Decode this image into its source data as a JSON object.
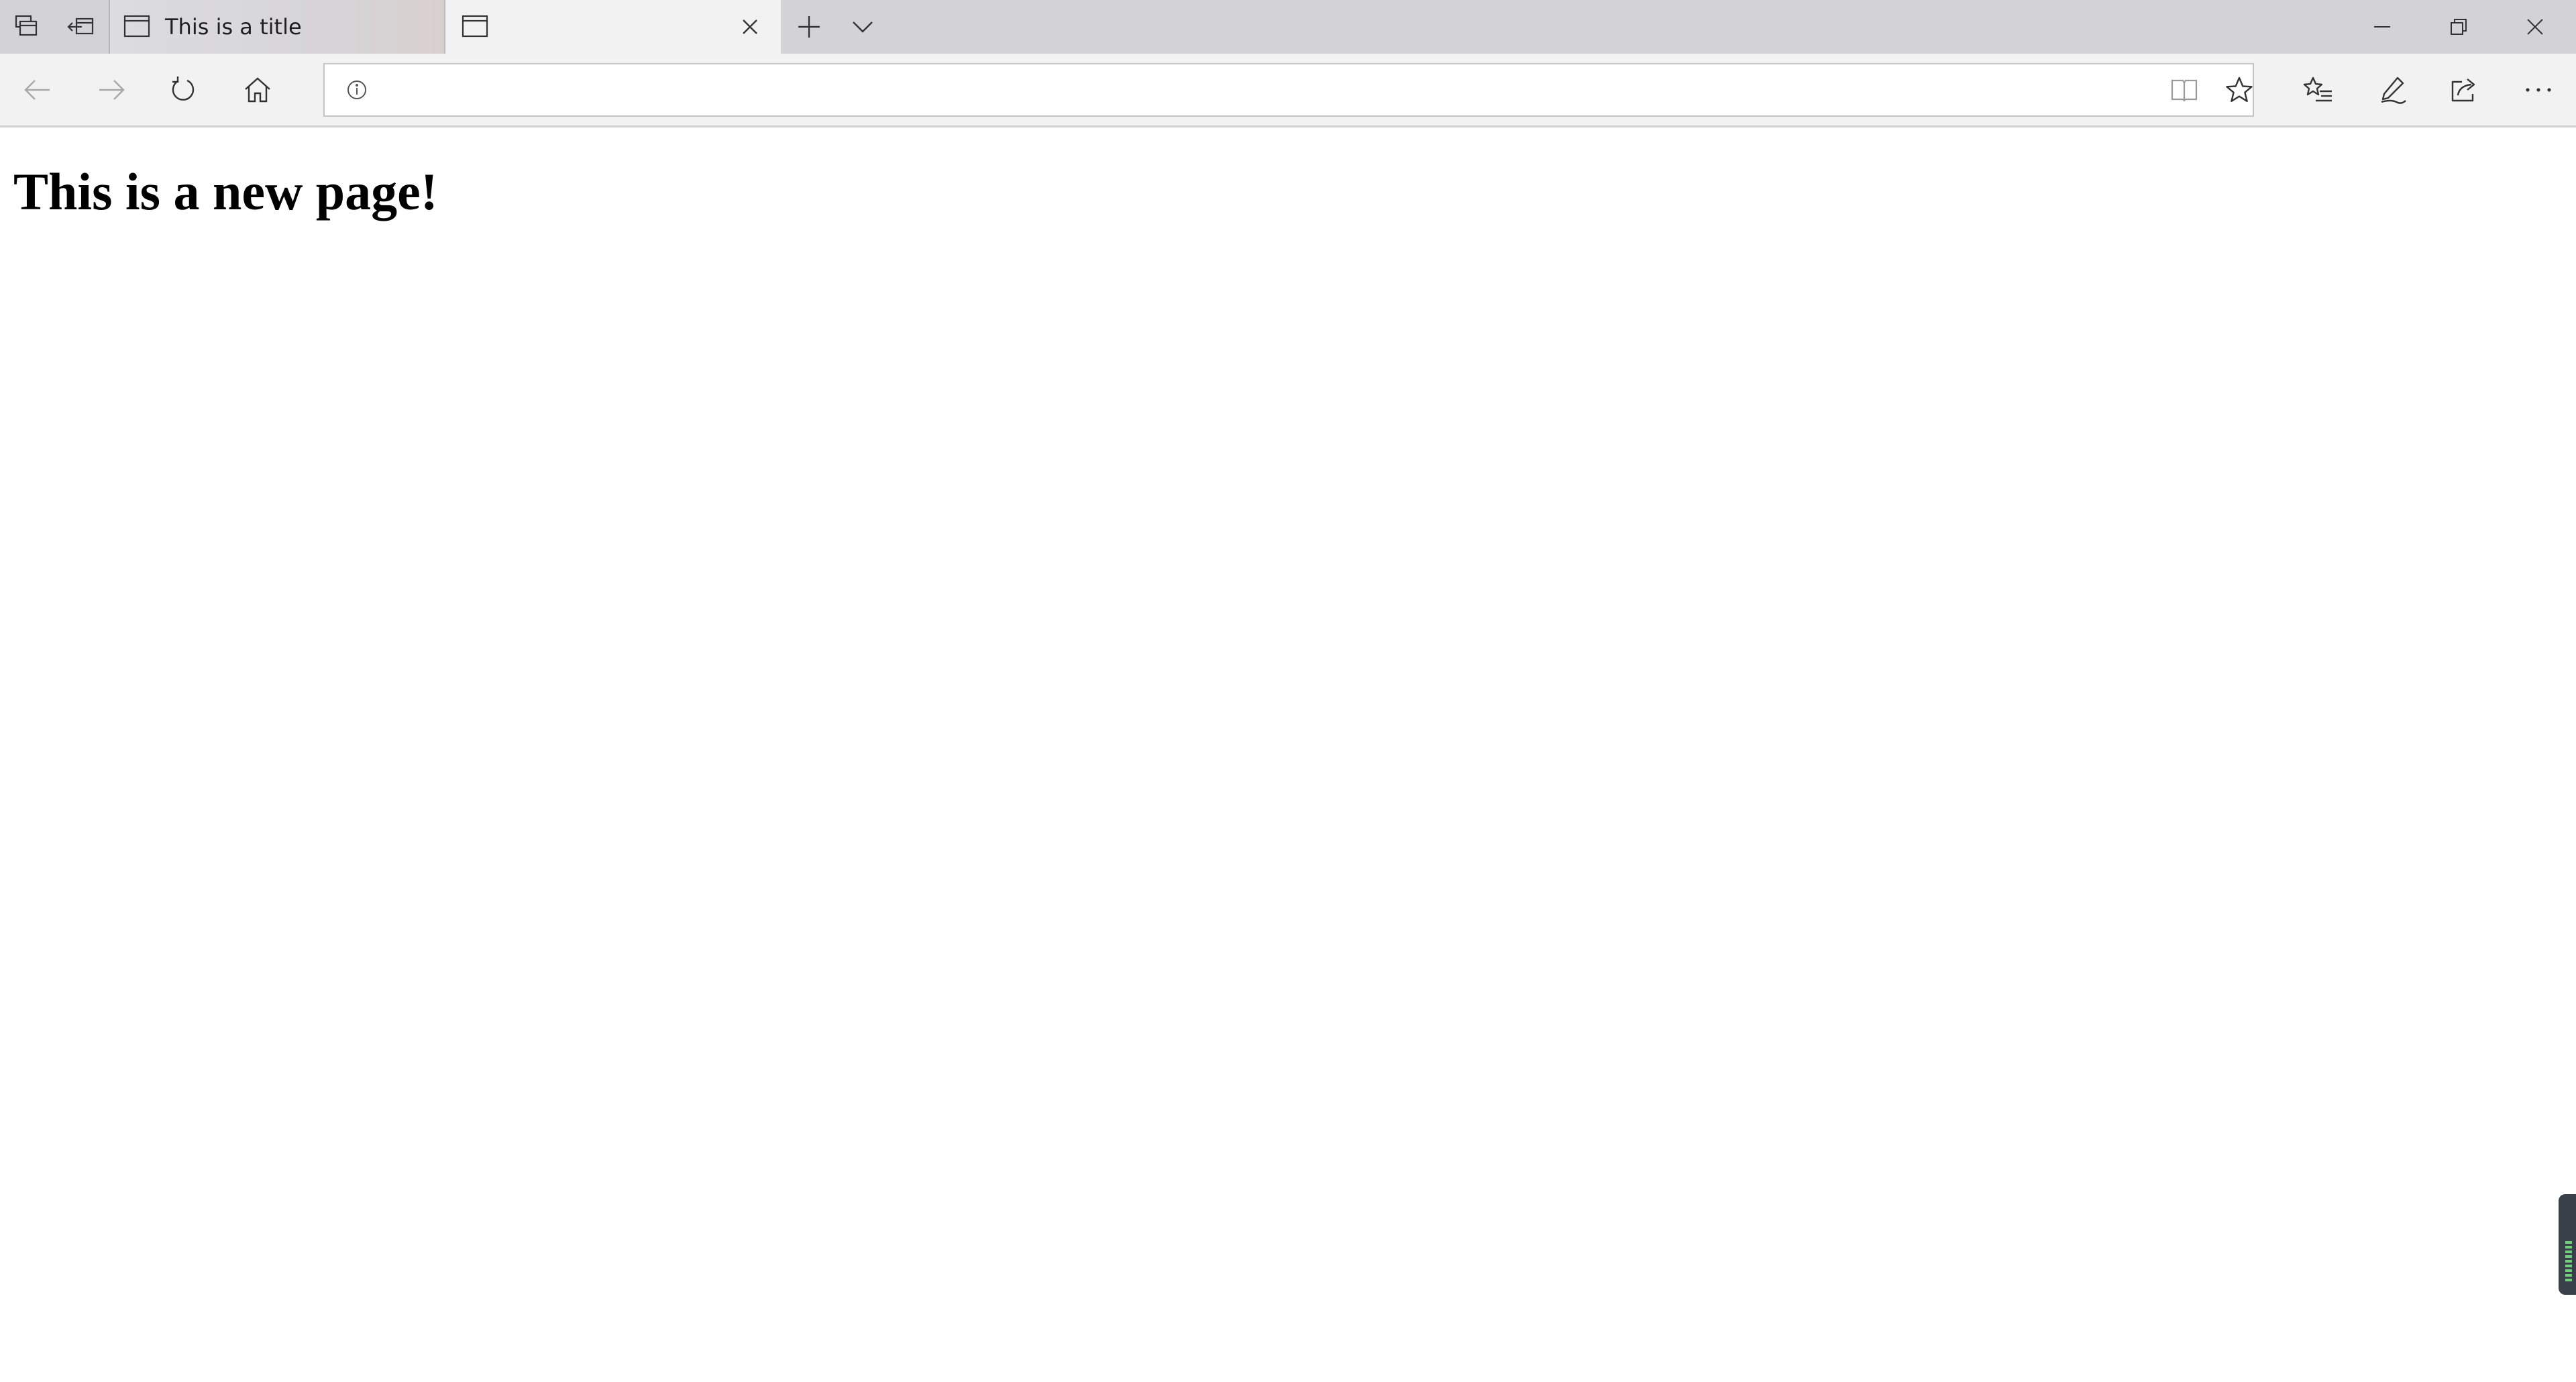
{
  "tabs": [
    {
      "title": "This is a title",
      "active": false,
      "favicon": "page-icon"
    },
    {
      "title": "",
      "active": true,
      "favicon": "page-icon",
      "title_obscured": true
    }
  ],
  "tabstrip": {
    "left_icons": [
      "tab-preview-icon",
      "set-tabs-aside-icon"
    ],
    "new_tab_icon": "plus-icon",
    "tab_list_icon": "chevron-down-icon"
  },
  "window_controls": [
    "minimize-icon",
    "restore-icon",
    "close-icon"
  ],
  "navigation": {
    "buttons": [
      "back-arrow-icon",
      "forward-arrow-icon",
      "refresh-icon",
      "home-icon"
    ],
    "back_enabled": false,
    "forward_enabled": false
  },
  "address_bar": {
    "url": "",
    "url_obscured": true,
    "info_icon": "info-icon",
    "reading_view_icon": "reading-view-icon",
    "favorite_icon": "star-icon"
  },
  "toolbar_right": [
    "favorites-list-icon",
    "pen-icon",
    "share-icon",
    "more-icon"
  ],
  "page": {
    "heading": "This is a new page!"
  },
  "colors": {
    "tabstrip_bg": "#d3d3d5",
    "toolbar_bg": "#f2f2f2",
    "page_bg": "#ffffff",
    "icon": "#333333",
    "icon_disabled": "#a8a8a8"
  }
}
